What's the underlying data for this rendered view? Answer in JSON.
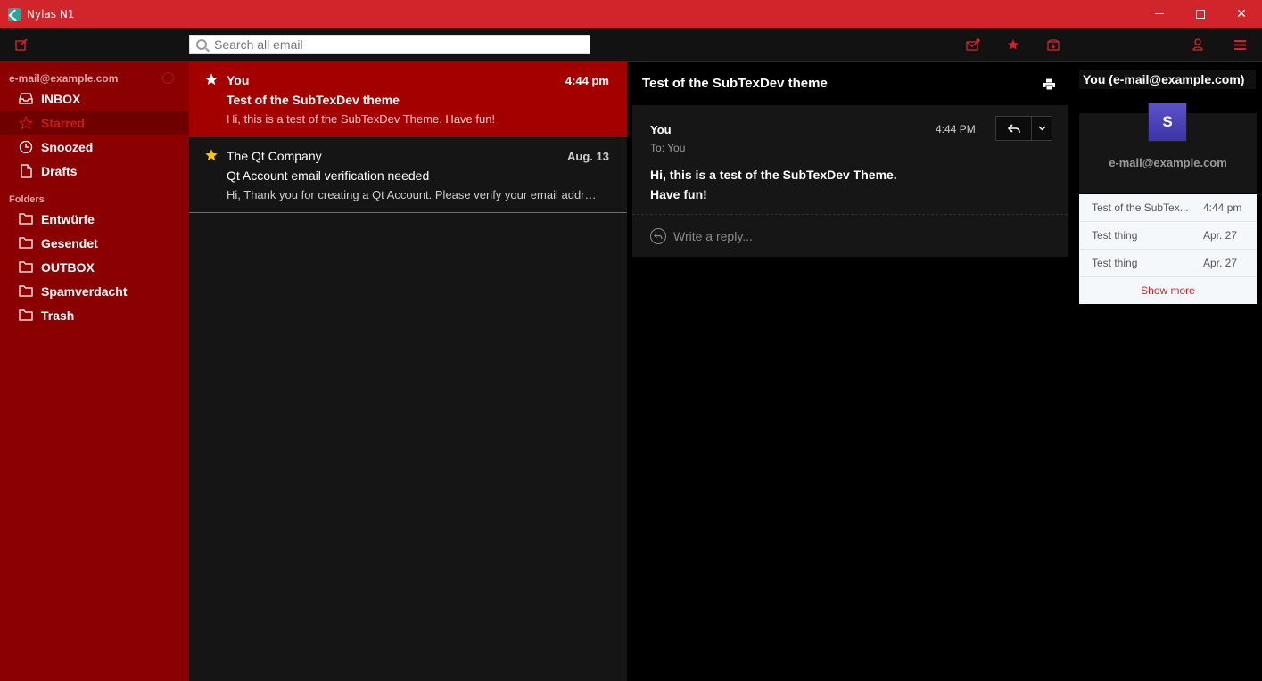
{
  "window": {
    "title": "Nylas N1",
    "controls": {
      "minimize": "",
      "maximize": "",
      "close": "✕"
    }
  },
  "toolbar": {
    "search_placeholder": "Search all email",
    "icons": [
      "compose-icon",
      "unread-mail-icon",
      "star-icon",
      "archive-icon",
      "account-icon",
      "menu-icon"
    ]
  },
  "sidebar": {
    "account": "e-mail@example.com",
    "items": [
      {
        "label": "INBOX",
        "icon": "inbox-icon"
      },
      {
        "label": "Starred",
        "icon": "star-outline-icon"
      },
      {
        "label": "Snoozed",
        "icon": "clock-icon"
      },
      {
        "label": "Drafts",
        "icon": "draft-icon"
      }
    ],
    "folders_heading": "Folders",
    "folders": [
      {
        "label": "Entwürfe",
        "icon": "folder-icon"
      },
      {
        "label": "Gesendet",
        "icon": "folder-icon"
      },
      {
        "label": "OUTBOX",
        "icon": "folder-icon"
      },
      {
        "label": "Spamverdacht",
        "icon": "folder-icon"
      },
      {
        "label": "Trash",
        "icon": "folder-icon"
      }
    ]
  },
  "messages": [
    {
      "from": "You",
      "time": "4:44 pm",
      "subject": "Test of the SubTexDev theme",
      "snippet": "Hi, this is a test of the SubTexDev Theme. Have fun!",
      "star_color": "#ffffff"
    },
    {
      "from": "The Qt Company",
      "time": "Aug. 13",
      "subject": "Qt Account email verification needed",
      "snippet": "Hi, Thank you for creating a Qt Account. Please verify your email address",
      "star_color": "#f5c518"
    }
  ],
  "reader": {
    "thread_title": "Test of the SubTexDev theme",
    "from": "You",
    "to": "To: You",
    "time": "4:44 PM",
    "body_line1": "Hi, this is a test of the SubTexDev Theme.",
    "body_line2": "Have fun!",
    "reply_placeholder": "Write a reply..."
  },
  "contact": {
    "name": "You (e-mail@example.com)",
    "avatar_letter": "S",
    "email": "e-mail@example.com",
    "threads": [
      {
        "subject": "Test of the SubTex...",
        "date": "4:44 pm"
      },
      {
        "subject": "Test thing",
        "date": "Apr. 27"
      },
      {
        "subject": "Test thing",
        "date": "Apr. 27"
      }
    ],
    "show_more": "Show more"
  },
  "colors": {
    "accent": "#d0252a",
    "sidebar_bg": "#8b0000",
    "selected_row": "#a50000",
    "avatar": "#4a42b8"
  }
}
